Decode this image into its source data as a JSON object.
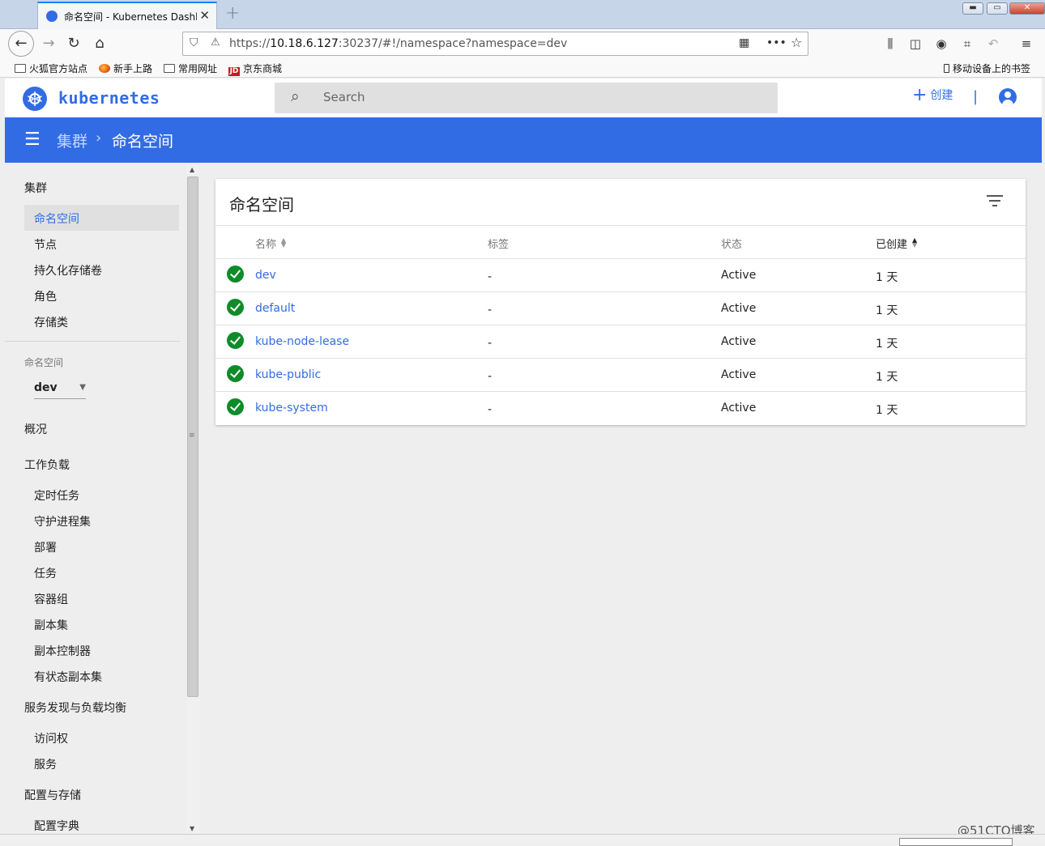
{
  "browser": {
    "tab_title": "命名空间 - Kubernetes Dashboard",
    "url_prefix": "https://",
    "url_host": "10.18.6.127",
    "url_rest": ":30237/#!/namespace?namespace=dev",
    "bookmarks": [
      "火狐官方站点",
      "新手上路",
      "常用网址",
      "京东商城"
    ],
    "mobile_bookmarks": "移动设备上的书签",
    "jd_icon": "JD"
  },
  "app": {
    "brand": "kubernetes",
    "search_placeholder": "Search",
    "create_label": "创建",
    "separator": "|"
  },
  "breadcrumb": {
    "parent": "集群",
    "current": "命名空间"
  },
  "sidebar": {
    "cluster_heading": "集群",
    "cluster_items": [
      "命名空间",
      "节点",
      "持久化存储卷",
      "角色",
      "存储类"
    ],
    "namespace_label": "命名空间",
    "namespace_selected": "dev",
    "overview": "概况",
    "workloads_heading": "工作负载",
    "workloads_items": [
      "定时任务",
      "守护进程集",
      "部署",
      "任务",
      "容器组",
      "副本集",
      "副本控制器",
      "有状态副本集"
    ],
    "discovery_heading": "服务发现与负载均衡",
    "discovery_items": [
      "访问权",
      "服务"
    ],
    "config_heading": "配置与存储",
    "config_items": [
      "配置字典"
    ]
  },
  "card": {
    "title": "命名空间",
    "columns": [
      "名称",
      "标签",
      "状态",
      "已创建"
    ],
    "rows": [
      {
        "name": "dev",
        "labels": "-",
        "status": "Active",
        "created": "1 天"
      },
      {
        "name": "default",
        "labels": "-",
        "status": "Active",
        "created": "1 天"
      },
      {
        "name": "kube-node-lease",
        "labels": "-",
        "status": "Active",
        "created": "1 天"
      },
      {
        "name": "kube-public",
        "labels": "-",
        "status": "Active",
        "created": "1 天"
      },
      {
        "name": "kube-system",
        "labels": "-",
        "status": "Active",
        "created": "1 天"
      }
    ]
  },
  "watermark": "@51CTO博客",
  "colors": {
    "primary": "#326ce5",
    "success": "#0f8b2a",
    "background": "#eeeeee"
  }
}
